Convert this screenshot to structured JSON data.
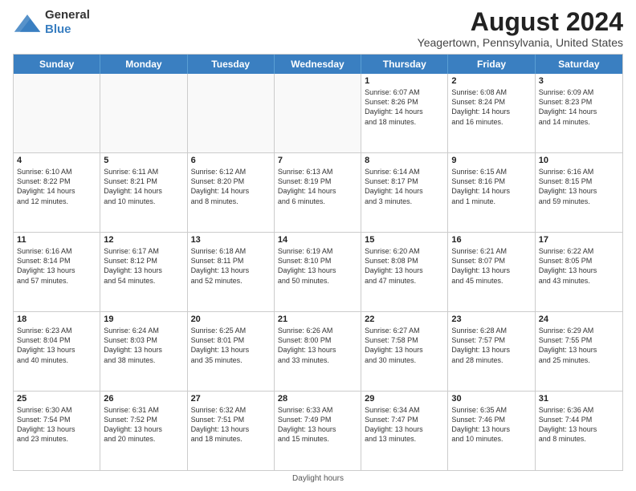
{
  "logo": {
    "text_general": "General",
    "text_blue": "Blue"
  },
  "title": "August 2024",
  "subtitle": "Yeagertown, Pennsylvania, United States",
  "weekdays": [
    "Sunday",
    "Monday",
    "Tuesday",
    "Wednesday",
    "Thursday",
    "Friday",
    "Saturday"
  ],
  "footer": "Daylight hours",
  "weeks": [
    [
      {
        "day": "",
        "text": "",
        "empty": true
      },
      {
        "day": "",
        "text": "",
        "empty": true
      },
      {
        "day": "",
        "text": "",
        "empty": true
      },
      {
        "day": "",
        "text": "",
        "empty": true
      },
      {
        "day": "1",
        "text": "Sunrise: 6:07 AM\nSunset: 8:26 PM\nDaylight: 14 hours\nand 18 minutes.",
        "empty": false
      },
      {
        "day": "2",
        "text": "Sunrise: 6:08 AM\nSunset: 8:24 PM\nDaylight: 14 hours\nand 16 minutes.",
        "empty": false
      },
      {
        "day": "3",
        "text": "Sunrise: 6:09 AM\nSunset: 8:23 PM\nDaylight: 14 hours\nand 14 minutes.",
        "empty": false
      }
    ],
    [
      {
        "day": "4",
        "text": "Sunrise: 6:10 AM\nSunset: 8:22 PM\nDaylight: 14 hours\nand 12 minutes.",
        "empty": false
      },
      {
        "day": "5",
        "text": "Sunrise: 6:11 AM\nSunset: 8:21 PM\nDaylight: 14 hours\nand 10 minutes.",
        "empty": false
      },
      {
        "day": "6",
        "text": "Sunrise: 6:12 AM\nSunset: 8:20 PM\nDaylight: 14 hours\nand 8 minutes.",
        "empty": false
      },
      {
        "day": "7",
        "text": "Sunrise: 6:13 AM\nSunset: 8:19 PM\nDaylight: 14 hours\nand 6 minutes.",
        "empty": false
      },
      {
        "day": "8",
        "text": "Sunrise: 6:14 AM\nSunset: 8:17 PM\nDaylight: 14 hours\nand 3 minutes.",
        "empty": false
      },
      {
        "day": "9",
        "text": "Sunrise: 6:15 AM\nSunset: 8:16 PM\nDaylight: 14 hours\nand 1 minute.",
        "empty": false
      },
      {
        "day": "10",
        "text": "Sunrise: 6:16 AM\nSunset: 8:15 PM\nDaylight: 13 hours\nand 59 minutes.",
        "empty": false
      }
    ],
    [
      {
        "day": "11",
        "text": "Sunrise: 6:16 AM\nSunset: 8:14 PM\nDaylight: 13 hours\nand 57 minutes.",
        "empty": false
      },
      {
        "day": "12",
        "text": "Sunrise: 6:17 AM\nSunset: 8:12 PM\nDaylight: 13 hours\nand 54 minutes.",
        "empty": false
      },
      {
        "day": "13",
        "text": "Sunrise: 6:18 AM\nSunset: 8:11 PM\nDaylight: 13 hours\nand 52 minutes.",
        "empty": false
      },
      {
        "day": "14",
        "text": "Sunrise: 6:19 AM\nSunset: 8:10 PM\nDaylight: 13 hours\nand 50 minutes.",
        "empty": false
      },
      {
        "day": "15",
        "text": "Sunrise: 6:20 AM\nSunset: 8:08 PM\nDaylight: 13 hours\nand 47 minutes.",
        "empty": false
      },
      {
        "day": "16",
        "text": "Sunrise: 6:21 AM\nSunset: 8:07 PM\nDaylight: 13 hours\nand 45 minutes.",
        "empty": false
      },
      {
        "day": "17",
        "text": "Sunrise: 6:22 AM\nSunset: 8:05 PM\nDaylight: 13 hours\nand 43 minutes.",
        "empty": false
      }
    ],
    [
      {
        "day": "18",
        "text": "Sunrise: 6:23 AM\nSunset: 8:04 PM\nDaylight: 13 hours\nand 40 minutes.",
        "empty": false
      },
      {
        "day": "19",
        "text": "Sunrise: 6:24 AM\nSunset: 8:03 PM\nDaylight: 13 hours\nand 38 minutes.",
        "empty": false
      },
      {
        "day": "20",
        "text": "Sunrise: 6:25 AM\nSunset: 8:01 PM\nDaylight: 13 hours\nand 35 minutes.",
        "empty": false
      },
      {
        "day": "21",
        "text": "Sunrise: 6:26 AM\nSunset: 8:00 PM\nDaylight: 13 hours\nand 33 minutes.",
        "empty": false
      },
      {
        "day": "22",
        "text": "Sunrise: 6:27 AM\nSunset: 7:58 PM\nDaylight: 13 hours\nand 30 minutes.",
        "empty": false
      },
      {
        "day": "23",
        "text": "Sunrise: 6:28 AM\nSunset: 7:57 PM\nDaylight: 13 hours\nand 28 minutes.",
        "empty": false
      },
      {
        "day": "24",
        "text": "Sunrise: 6:29 AM\nSunset: 7:55 PM\nDaylight: 13 hours\nand 25 minutes.",
        "empty": false
      }
    ],
    [
      {
        "day": "25",
        "text": "Sunrise: 6:30 AM\nSunset: 7:54 PM\nDaylight: 13 hours\nand 23 minutes.",
        "empty": false
      },
      {
        "day": "26",
        "text": "Sunrise: 6:31 AM\nSunset: 7:52 PM\nDaylight: 13 hours\nand 20 minutes.",
        "empty": false
      },
      {
        "day": "27",
        "text": "Sunrise: 6:32 AM\nSunset: 7:51 PM\nDaylight: 13 hours\nand 18 minutes.",
        "empty": false
      },
      {
        "day": "28",
        "text": "Sunrise: 6:33 AM\nSunset: 7:49 PM\nDaylight: 13 hours\nand 15 minutes.",
        "empty": false
      },
      {
        "day": "29",
        "text": "Sunrise: 6:34 AM\nSunset: 7:47 PM\nDaylight: 13 hours\nand 13 minutes.",
        "empty": false
      },
      {
        "day": "30",
        "text": "Sunrise: 6:35 AM\nSunset: 7:46 PM\nDaylight: 13 hours\nand 10 minutes.",
        "empty": false
      },
      {
        "day": "31",
        "text": "Sunrise: 6:36 AM\nSunset: 7:44 PM\nDaylight: 13 hours\nand 8 minutes.",
        "empty": false
      }
    ]
  ]
}
